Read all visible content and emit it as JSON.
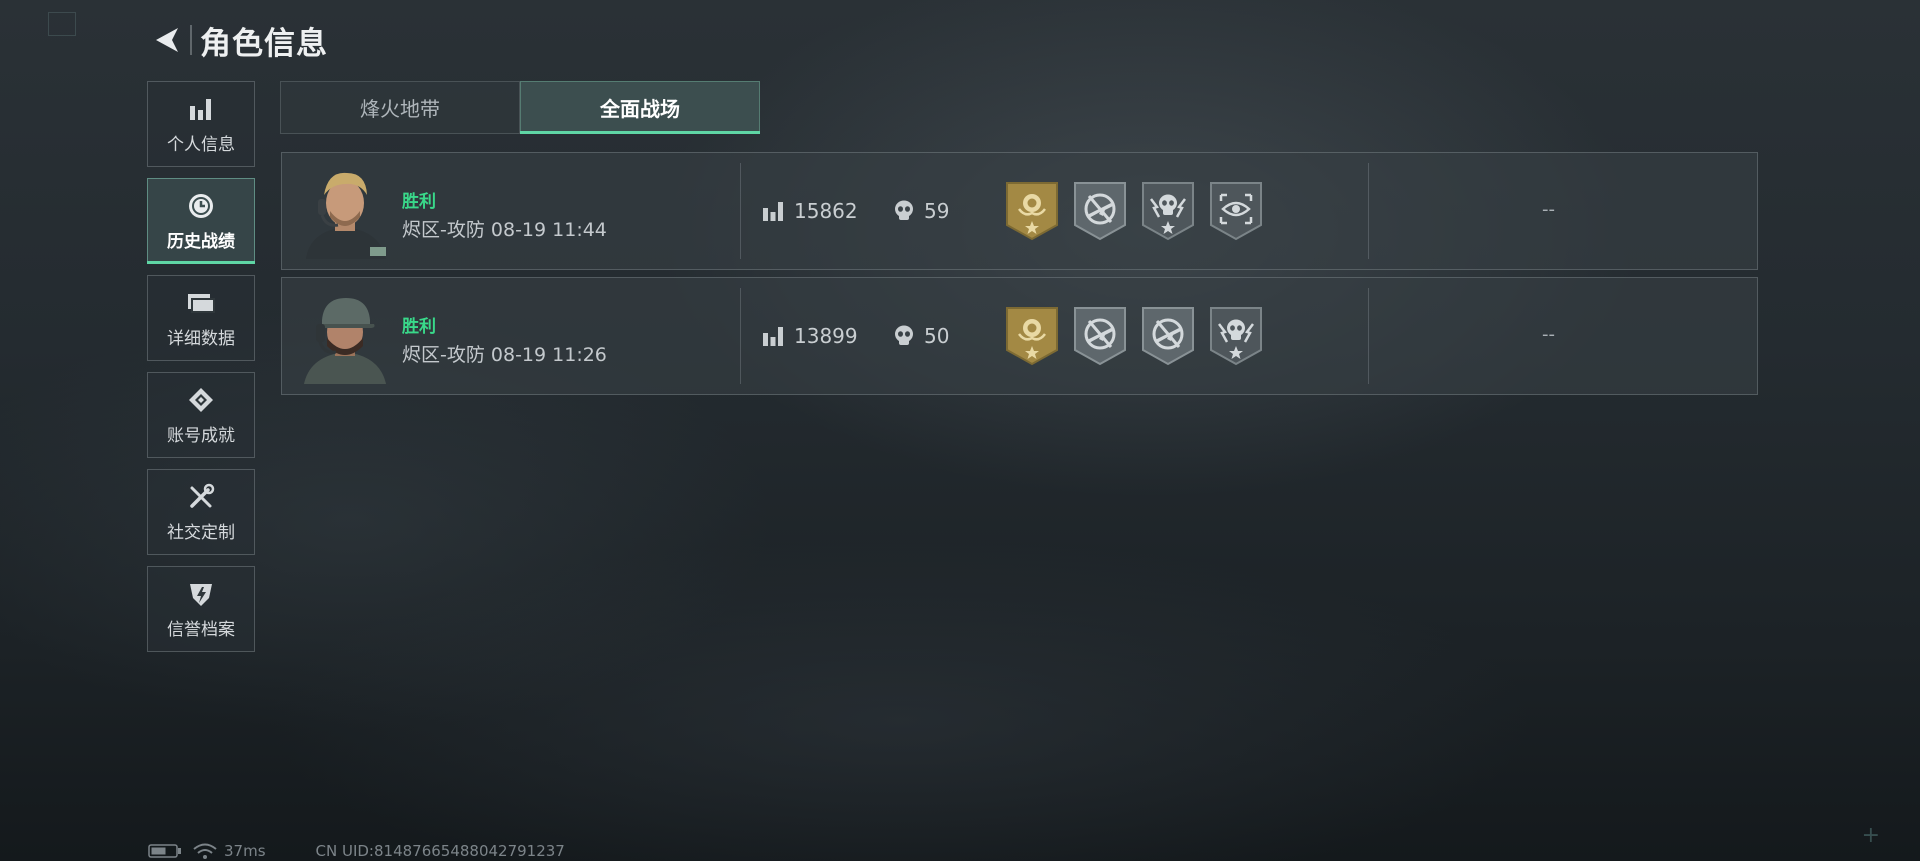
{
  "header": {
    "title": "角色信息"
  },
  "sidebar": {
    "items": [
      {
        "label": "个人信息",
        "icon": "bar-chart-icon"
      },
      {
        "label": "历史战绩",
        "icon": "clock-icon"
      },
      {
        "label": "详细数据",
        "icon": "folder-icon"
      },
      {
        "label": "账号成就",
        "icon": "achievement-icon"
      },
      {
        "label": "社交定制",
        "icon": "tools-icon"
      },
      {
        "label": "信誉档案",
        "icon": "credit-shield-icon"
      }
    ],
    "active_index": 1
  },
  "tabs": [
    {
      "label": "烽火地带"
    },
    {
      "label": "全面战场"
    }
  ],
  "active_tab": 1,
  "matches": [
    {
      "result": "胜利",
      "detail": "烬区-攻防 08-19 11:44",
      "score": "15862",
      "kills": "59",
      "badges": [
        "gold-rose-medal-icon",
        "no-gun-medal-icon",
        "skull-lightning-medal-icon",
        "eye-target-medal-icon"
      ],
      "extra": "--"
    },
    {
      "result": "胜利",
      "detail": "烬区-攻防 08-19 11:26",
      "score": "13899",
      "kills": "50",
      "badges": [
        "gold-rose-medal-icon",
        "no-gun-medal-icon",
        "no-gun-medal-icon",
        "skull-lightning-medal-icon"
      ],
      "extra": "--"
    }
  ],
  "footer": {
    "ping": "37ms",
    "uid": "CN UID:8148766548804279123​7"
  },
  "colors": {
    "accent": "#5fd6a5",
    "victory": "#39d98a",
    "gold_medal": "#b89a4a"
  }
}
